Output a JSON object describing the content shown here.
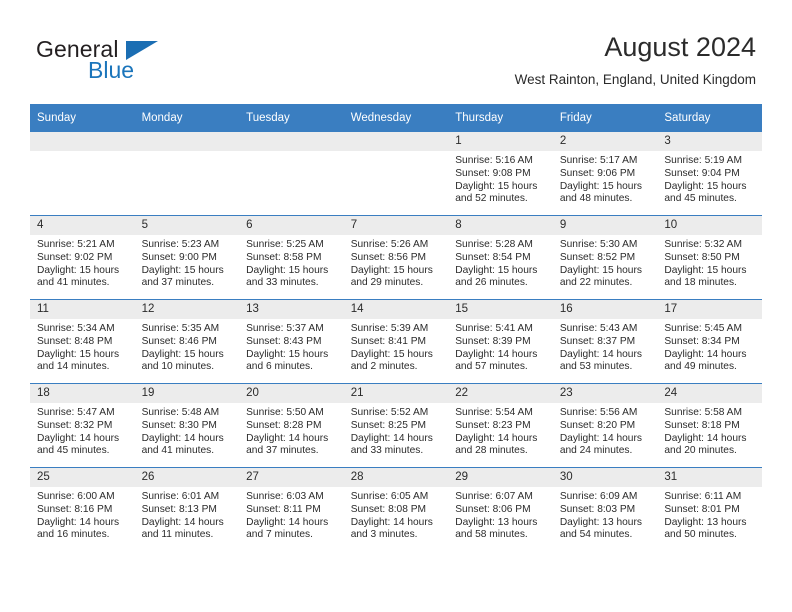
{
  "branding": {
    "name_part1": "General",
    "name_part2": "Blue",
    "flag_icon": "triangle-flag-icon",
    "accent_color": "#1b75bb"
  },
  "header": {
    "month_title": "August 2024",
    "location": "West Rainton, England, United Kingdom",
    "header_bg_color": "#3a7ec1",
    "daynum_bg_color": "#ececec"
  },
  "weekday_headers": [
    "Sunday",
    "Monday",
    "Tuesday",
    "Wednesday",
    "Thursday",
    "Friday",
    "Saturday"
  ],
  "weeks": [
    [
      {
        "day": "",
        "blank": true
      },
      {
        "day": "",
        "blank": true
      },
      {
        "day": "",
        "blank": true
      },
      {
        "day": "",
        "blank": true
      },
      {
        "day": "1",
        "sunrise": "Sunrise: 5:16 AM",
        "sunset": "Sunset: 9:08 PM",
        "daylight_line1": "Daylight: 15 hours",
        "daylight_line2": "and 52 minutes."
      },
      {
        "day": "2",
        "sunrise": "Sunrise: 5:17 AM",
        "sunset": "Sunset: 9:06 PM",
        "daylight_line1": "Daylight: 15 hours",
        "daylight_line2": "and 48 minutes."
      },
      {
        "day": "3",
        "sunrise": "Sunrise: 5:19 AM",
        "sunset": "Sunset: 9:04 PM",
        "daylight_line1": "Daylight: 15 hours",
        "daylight_line2": "and 45 minutes."
      }
    ],
    [
      {
        "day": "4",
        "sunrise": "Sunrise: 5:21 AM",
        "sunset": "Sunset: 9:02 PM",
        "daylight_line1": "Daylight: 15 hours",
        "daylight_line2": "and 41 minutes."
      },
      {
        "day": "5",
        "sunrise": "Sunrise: 5:23 AM",
        "sunset": "Sunset: 9:00 PM",
        "daylight_line1": "Daylight: 15 hours",
        "daylight_line2": "and 37 minutes."
      },
      {
        "day": "6",
        "sunrise": "Sunrise: 5:25 AM",
        "sunset": "Sunset: 8:58 PM",
        "daylight_line1": "Daylight: 15 hours",
        "daylight_line2": "and 33 minutes."
      },
      {
        "day": "7",
        "sunrise": "Sunrise: 5:26 AM",
        "sunset": "Sunset: 8:56 PM",
        "daylight_line1": "Daylight: 15 hours",
        "daylight_line2": "and 29 minutes."
      },
      {
        "day": "8",
        "sunrise": "Sunrise: 5:28 AM",
        "sunset": "Sunset: 8:54 PM",
        "daylight_line1": "Daylight: 15 hours",
        "daylight_line2": "and 26 minutes."
      },
      {
        "day": "9",
        "sunrise": "Sunrise: 5:30 AM",
        "sunset": "Sunset: 8:52 PM",
        "daylight_line1": "Daylight: 15 hours",
        "daylight_line2": "and 22 minutes."
      },
      {
        "day": "10",
        "sunrise": "Sunrise: 5:32 AM",
        "sunset": "Sunset: 8:50 PM",
        "daylight_line1": "Daylight: 15 hours",
        "daylight_line2": "and 18 minutes."
      }
    ],
    [
      {
        "day": "11",
        "sunrise": "Sunrise: 5:34 AM",
        "sunset": "Sunset: 8:48 PM",
        "daylight_line1": "Daylight: 15 hours",
        "daylight_line2": "and 14 minutes."
      },
      {
        "day": "12",
        "sunrise": "Sunrise: 5:35 AM",
        "sunset": "Sunset: 8:46 PM",
        "daylight_line1": "Daylight: 15 hours",
        "daylight_line2": "and 10 minutes."
      },
      {
        "day": "13",
        "sunrise": "Sunrise: 5:37 AM",
        "sunset": "Sunset: 8:43 PM",
        "daylight_line1": "Daylight: 15 hours",
        "daylight_line2": "and 6 minutes."
      },
      {
        "day": "14",
        "sunrise": "Sunrise: 5:39 AM",
        "sunset": "Sunset: 8:41 PM",
        "daylight_line1": "Daylight: 15 hours",
        "daylight_line2": "and 2 minutes."
      },
      {
        "day": "15",
        "sunrise": "Sunrise: 5:41 AM",
        "sunset": "Sunset: 8:39 PM",
        "daylight_line1": "Daylight: 14 hours",
        "daylight_line2": "and 57 minutes."
      },
      {
        "day": "16",
        "sunrise": "Sunrise: 5:43 AM",
        "sunset": "Sunset: 8:37 PM",
        "daylight_line1": "Daylight: 14 hours",
        "daylight_line2": "and 53 minutes."
      },
      {
        "day": "17",
        "sunrise": "Sunrise: 5:45 AM",
        "sunset": "Sunset: 8:34 PM",
        "daylight_line1": "Daylight: 14 hours",
        "daylight_line2": "and 49 minutes."
      }
    ],
    [
      {
        "day": "18",
        "sunrise": "Sunrise: 5:47 AM",
        "sunset": "Sunset: 8:32 PM",
        "daylight_line1": "Daylight: 14 hours",
        "daylight_line2": "and 45 minutes."
      },
      {
        "day": "19",
        "sunrise": "Sunrise: 5:48 AM",
        "sunset": "Sunset: 8:30 PM",
        "daylight_line1": "Daylight: 14 hours",
        "daylight_line2": "and 41 minutes."
      },
      {
        "day": "20",
        "sunrise": "Sunrise: 5:50 AM",
        "sunset": "Sunset: 8:28 PM",
        "daylight_line1": "Daylight: 14 hours",
        "daylight_line2": "and 37 minutes."
      },
      {
        "day": "21",
        "sunrise": "Sunrise: 5:52 AM",
        "sunset": "Sunset: 8:25 PM",
        "daylight_line1": "Daylight: 14 hours",
        "daylight_line2": "and 33 minutes."
      },
      {
        "day": "22",
        "sunrise": "Sunrise: 5:54 AM",
        "sunset": "Sunset: 8:23 PM",
        "daylight_line1": "Daylight: 14 hours",
        "daylight_line2": "and 28 minutes."
      },
      {
        "day": "23",
        "sunrise": "Sunrise: 5:56 AM",
        "sunset": "Sunset: 8:20 PM",
        "daylight_line1": "Daylight: 14 hours",
        "daylight_line2": "and 24 minutes."
      },
      {
        "day": "24",
        "sunrise": "Sunrise: 5:58 AM",
        "sunset": "Sunset: 8:18 PM",
        "daylight_line1": "Daylight: 14 hours",
        "daylight_line2": "and 20 minutes."
      }
    ],
    [
      {
        "day": "25",
        "sunrise": "Sunrise: 6:00 AM",
        "sunset": "Sunset: 8:16 PM",
        "daylight_line1": "Daylight: 14 hours",
        "daylight_line2": "and 16 minutes."
      },
      {
        "day": "26",
        "sunrise": "Sunrise: 6:01 AM",
        "sunset": "Sunset: 8:13 PM",
        "daylight_line1": "Daylight: 14 hours",
        "daylight_line2": "and 11 minutes."
      },
      {
        "day": "27",
        "sunrise": "Sunrise: 6:03 AM",
        "sunset": "Sunset: 8:11 PM",
        "daylight_line1": "Daylight: 14 hours",
        "daylight_line2": "and 7 minutes."
      },
      {
        "day": "28",
        "sunrise": "Sunrise: 6:05 AM",
        "sunset": "Sunset: 8:08 PM",
        "daylight_line1": "Daylight: 14 hours",
        "daylight_line2": "and 3 minutes."
      },
      {
        "day": "29",
        "sunrise": "Sunrise: 6:07 AM",
        "sunset": "Sunset: 8:06 PM",
        "daylight_line1": "Daylight: 13 hours",
        "daylight_line2": "and 58 minutes."
      },
      {
        "day": "30",
        "sunrise": "Sunrise: 6:09 AM",
        "sunset": "Sunset: 8:03 PM",
        "daylight_line1": "Daylight: 13 hours",
        "daylight_line2": "and 54 minutes."
      },
      {
        "day": "31",
        "sunrise": "Sunrise: 6:11 AM",
        "sunset": "Sunset: 8:01 PM",
        "daylight_line1": "Daylight: 13 hours",
        "daylight_line2": "and 50 minutes."
      }
    ]
  ]
}
